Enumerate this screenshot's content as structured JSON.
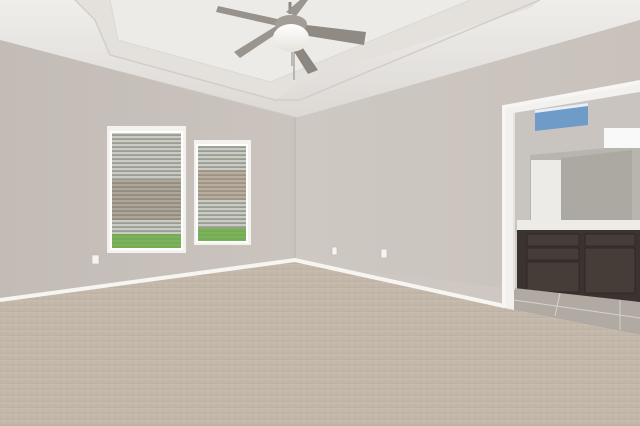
{
  "scene": {
    "subject": "empty-bedroom",
    "features": [
      "tray-ceiling",
      "ceiling-fan",
      "double-window-with-blinds",
      "carpet-floor",
      "doorway-to-bathroom",
      "bathroom-vanity",
      "tile-floor",
      "wall-outlets"
    ],
    "colors": {
      "wall_left": "#c5beb8",
      "wall_right": "#cbc4be",
      "ceiling": "#e8e6e3",
      "carpet": "#c4b8aa",
      "trim": "#f4f3f0",
      "vanity": "#3b3330",
      "countertop": "#ecebe6",
      "tile": "#b0aaa2",
      "window_glass": "#8a9080",
      "lawn": "#6fae4a"
    }
  }
}
